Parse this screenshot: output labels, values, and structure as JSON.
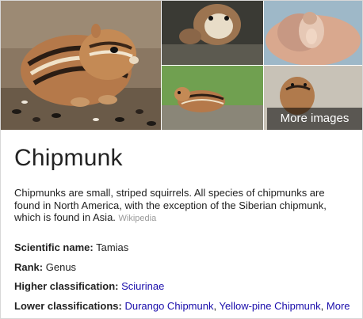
{
  "images": {
    "more_images_label": "More images"
  },
  "entity": {
    "title": "Chipmunk",
    "description": "Chipmunks are small, striped squirrels. All species of chipmunks are found in North America, with the exception of the Siberian chipmunk, which is found in Asia.",
    "source_label": "Wikipedia"
  },
  "facts": {
    "scientific_name": {
      "label": "Scientific name:",
      "value": "Tamias"
    },
    "rank": {
      "label": "Rank:",
      "value": "Genus"
    },
    "higher_classification": {
      "label": "Higher classification:",
      "link": "Sciurinae"
    },
    "lower_classifications": {
      "label": "Lower classifications:",
      "links": [
        "Durango Chipmunk",
        "Yellow-pine Chipmunk",
        "More"
      ],
      "separator": ","
    }
  },
  "colors": {
    "link": "#1a0dab",
    "text": "#222222",
    "source": "#999999",
    "border": "#d8d8d8"
  }
}
